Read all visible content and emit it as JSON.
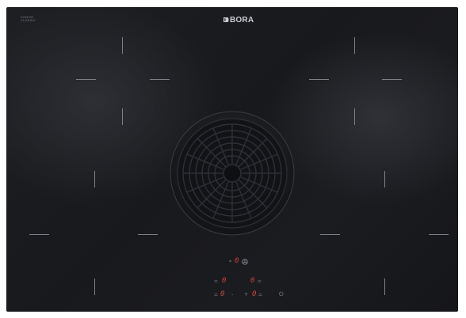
{
  "brand": {
    "small_line1": "SONOS",
    "small_line2": "CLASSIC",
    "logo_text": "BORA",
    "logo_icon": "bora-logo-icon"
  },
  "colors": {
    "glass": "#1b1c20",
    "marks": "#7e8088",
    "display_red": "#d2403d",
    "fan_grille": "#2a2c31"
  },
  "controls": {
    "fan_row": {
      "star": "*",
      "value": "0",
      "fan_icon": "fan-icon"
    },
    "left_zone": {
      "front_lines": "=",
      "front_value": "0",
      "rear_lines": "=",
      "rear_value": "0"
    },
    "right_zone": {
      "front_value": "0",
      "front_lines": "=",
      "rear_value": "0",
      "rear_lines": "="
    },
    "separator_left": "-",
    "separator_right": "+",
    "power_icon": "power-icon",
    "power_symbol": "⏻"
  }
}
